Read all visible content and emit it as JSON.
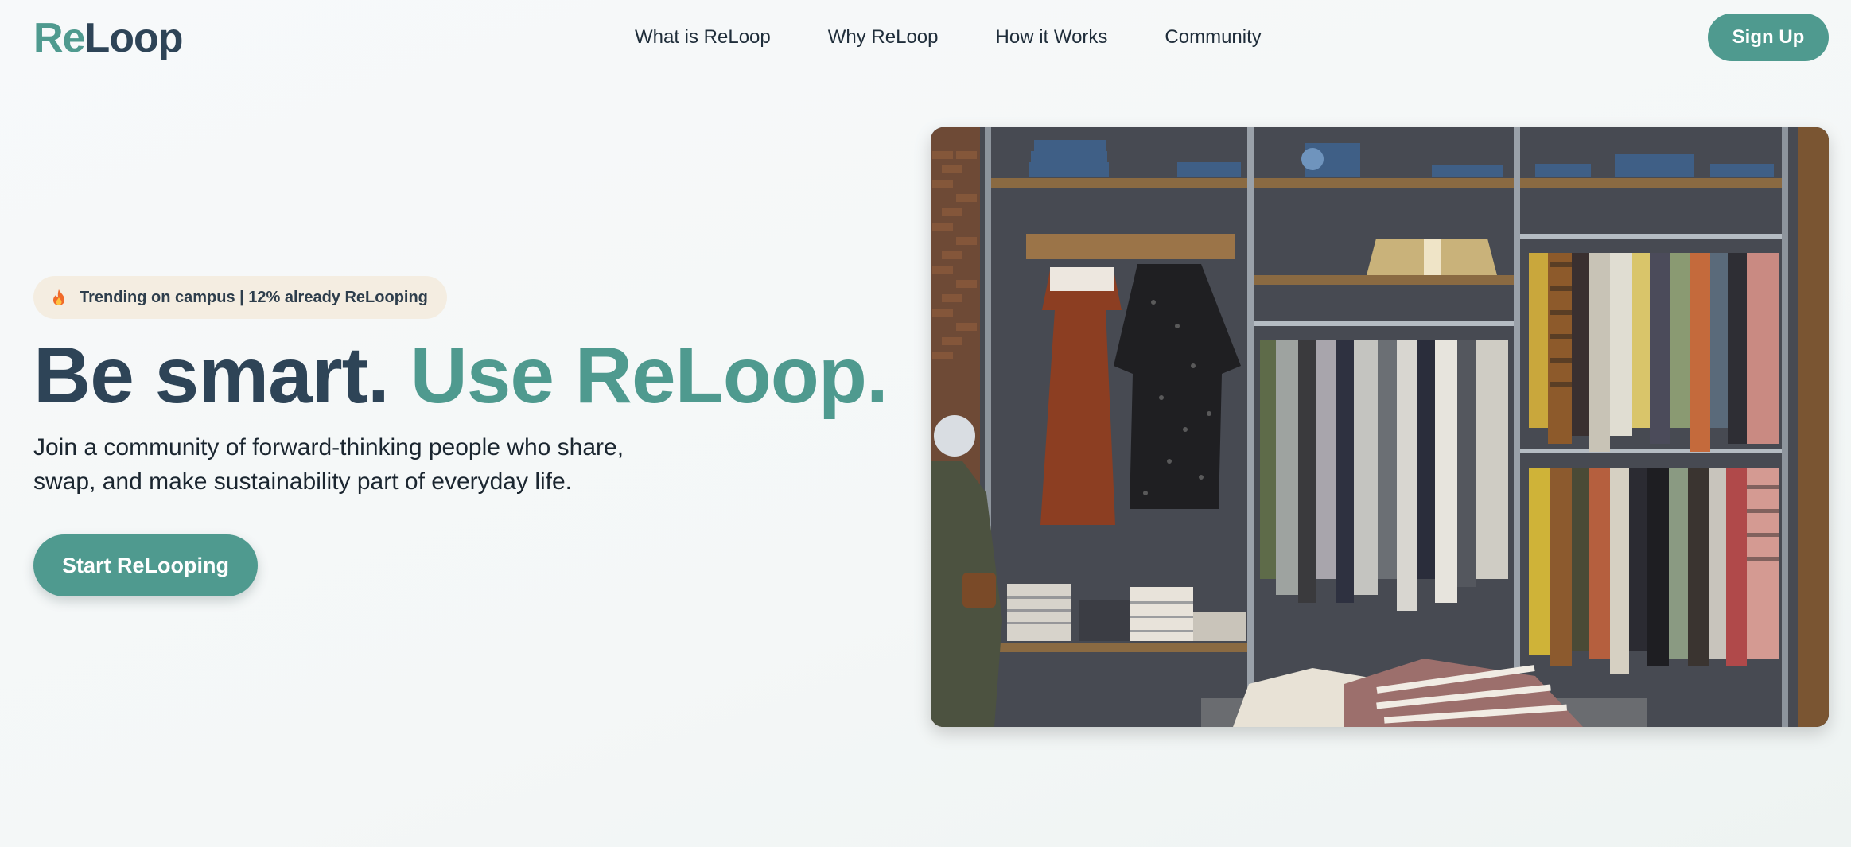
{
  "brand": {
    "logo_re": "Re",
    "logo_loop": "Loop"
  },
  "nav": {
    "links": [
      "What is ReLoop",
      "Why ReLoop",
      "How it Works",
      "Community"
    ],
    "signup_label": "Sign Up"
  },
  "hero": {
    "badge_icon": "flame-icon",
    "badge_text": "Trending on campus | 12% already ReLooping",
    "headline_part1": "Be smart.",
    "headline_part2": "Use ReLoop.",
    "subtitle_line1": "Join a community of forward-thinking people who share,",
    "subtitle_line2": "swap, and make sustainability part of everyday life.",
    "cta_label": "Start ReLooping",
    "image_subject": "clothing-rack-photo"
  },
  "colors": {
    "accent": "#4f9a8f",
    "dark": "#2e4457",
    "badge_bg": "#f4ede1",
    "background": "#f6f8f9"
  }
}
